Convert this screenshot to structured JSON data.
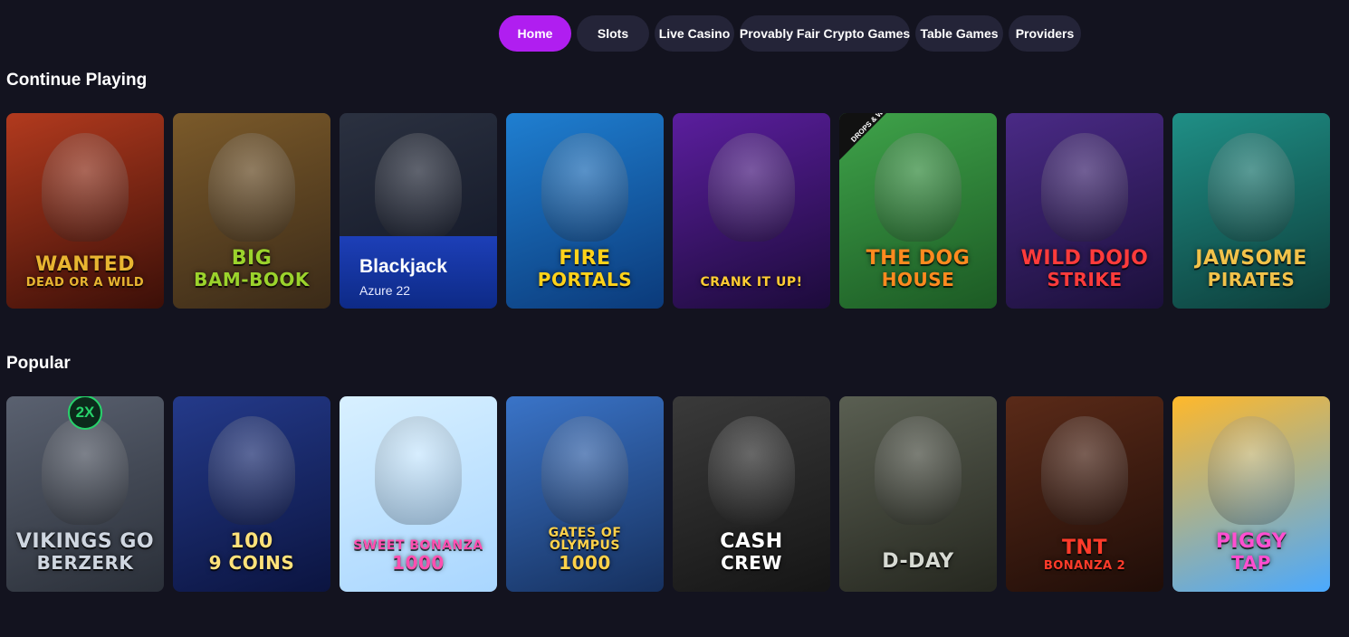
{
  "nav": {
    "tabs": [
      {
        "label": "Home",
        "active": true
      },
      {
        "label": "Slots",
        "active": false
      },
      {
        "label": "Live Casino",
        "active": false
      },
      {
        "label": "Provably Fair Crypto Games",
        "active": false
      },
      {
        "label": "Table Games",
        "active": false
      },
      {
        "label": "Providers",
        "active": false
      }
    ]
  },
  "sections": {
    "continue": {
      "title": "Continue Playing",
      "games": [
        {
          "logo": "WANTED",
          "sub": "DEAD OR A WILD",
          "bg": [
            "#b23a1e",
            "#3b0f08"
          ],
          "logo_color": "#e8b531"
        },
        {
          "logo": "BIG",
          "sub": "BAM-BOOK",
          "bg": [
            "#7b5a2a",
            "#3a2a18"
          ],
          "logo_color": "#9bd32c"
        },
        {
          "logo": "Blackjack",
          "sub": "Azure 22",
          "bg": [
            "#2b3140",
            "#0f1424"
          ],
          "logo_color": "#ffffff"
        },
        {
          "logo": "FIRE",
          "sub": "PORTALS",
          "bg": [
            "#1f7fd1",
            "#0b3a7a"
          ],
          "logo_color": "#ffd21a"
        },
        {
          "logo": "CRANK IT UP!",
          "sub": "",
          "bg": [
            "#5b1e9e",
            "#1c0b3a"
          ],
          "logo_color": "#ffcc33"
        },
        {
          "logo": "THE DOG",
          "sub": "HOUSE",
          "bg": [
            "#3fa34a",
            "#1c5a24"
          ],
          "logo_color": "#ff8a1f",
          "ribbon": "DROPS & WINS"
        },
        {
          "logo": "WILD DOJO",
          "sub": "STRIKE",
          "bg": [
            "#4a2a86",
            "#1b103a"
          ],
          "logo_color": "#ff3b3b"
        },
        {
          "logo": "JAWSOME",
          "sub": "PIRATES",
          "bg": [
            "#1f8f86",
            "#0d3d3a"
          ],
          "logo_color": "#f2c24a"
        }
      ]
    },
    "popular": {
      "title": "Popular",
      "games": [
        {
          "logo": "VIKINGS GO",
          "sub": "BERZERK",
          "bg": [
            "#5a6170",
            "#2a2f38"
          ],
          "logo_color": "#cfd6e0",
          "badge": "2X"
        },
        {
          "logo": "100",
          "sub": "9 COINS",
          "bg": [
            "#243a8a",
            "#0b1440"
          ],
          "logo_color": "#ffe27a"
        },
        {
          "logo": "SWEET BONANZA",
          "sub": "1000",
          "bg": [
            "#d8f0ff",
            "#a9d6ff"
          ],
          "logo_color": "#ff4fb0"
        },
        {
          "logo": "GATES OF OLYMPUS",
          "sub": "1000",
          "bg": [
            "#3a74c8",
            "#16305e"
          ],
          "logo_color": "#ffd24a"
        },
        {
          "logo": "CASH",
          "sub": "CREW",
          "bg": [
            "#3a3a3a",
            "#151515"
          ],
          "logo_color": "#ffffff"
        },
        {
          "logo": "D-DAY",
          "sub": "",
          "bg": [
            "#5a5f52",
            "#25271f"
          ],
          "logo_color": "#d7dad3"
        },
        {
          "logo": "TNT",
          "sub": "BONANZA 2",
          "bg": [
            "#5a2a18",
            "#1f0d08"
          ],
          "logo_color": "#ff3b2a"
        },
        {
          "logo": "PIGGY",
          "sub": "TAP",
          "bg": [
            "#ffb82a",
            "#4aa9ff"
          ],
          "logo_color": "#ff4fd0"
        }
      ]
    }
  }
}
